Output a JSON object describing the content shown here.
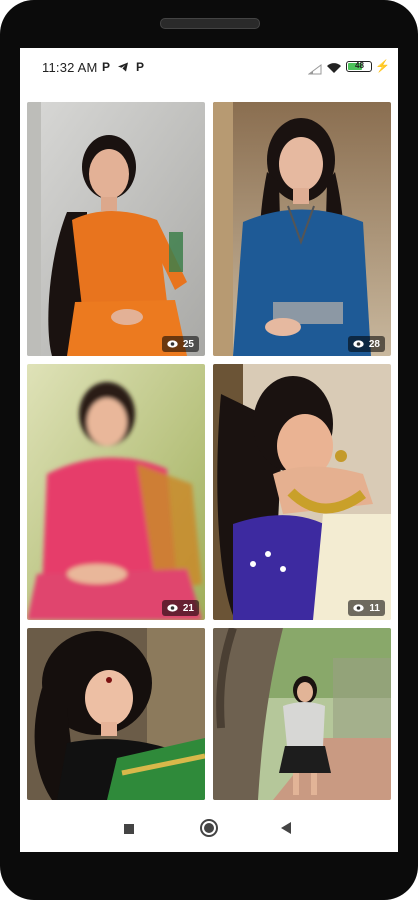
{
  "status_bar": {
    "time": "11:32 AM",
    "notification_icons": [
      "p-icon",
      "telegram-icon",
      "p-icon"
    ],
    "system_icons": [
      "signal-icon",
      "wifi-icon",
      "battery-icon",
      "charging-icon"
    ],
    "battery_label": "48"
  },
  "gallery": {
    "tiles": [
      {
        "views": "25",
        "outfit": "orange blouse and skirt"
      },
      {
        "views": "28",
        "outfit": "blue blouse"
      },
      {
        "views": "21",
        "outfit": "pink top with dupatta"
      },
      {
        "views": "11",
        "outfit": "purple blouse with gold necklace"
      },
      {
        "views": "",
        "outfit": "green saree"
      },
      {
        "views": "",
        "outfit": "grey top under tree"
      }
    ]
  },
  "navigation": {
    "buttons": [
      "recents-button",
      "home-button",
      "back-button"
    ]
  },
  "colors": {
    "orange_outfit": "#e8741e",
    "blue_outfit": "#1e5a96",
    "pink_outfit": "#e63e6a",
    "purple_outfit": "#3d2aa0",
    "green_saree": "#2f8a3a",
    "tree_park": "#7a8a5a"
  }
}
